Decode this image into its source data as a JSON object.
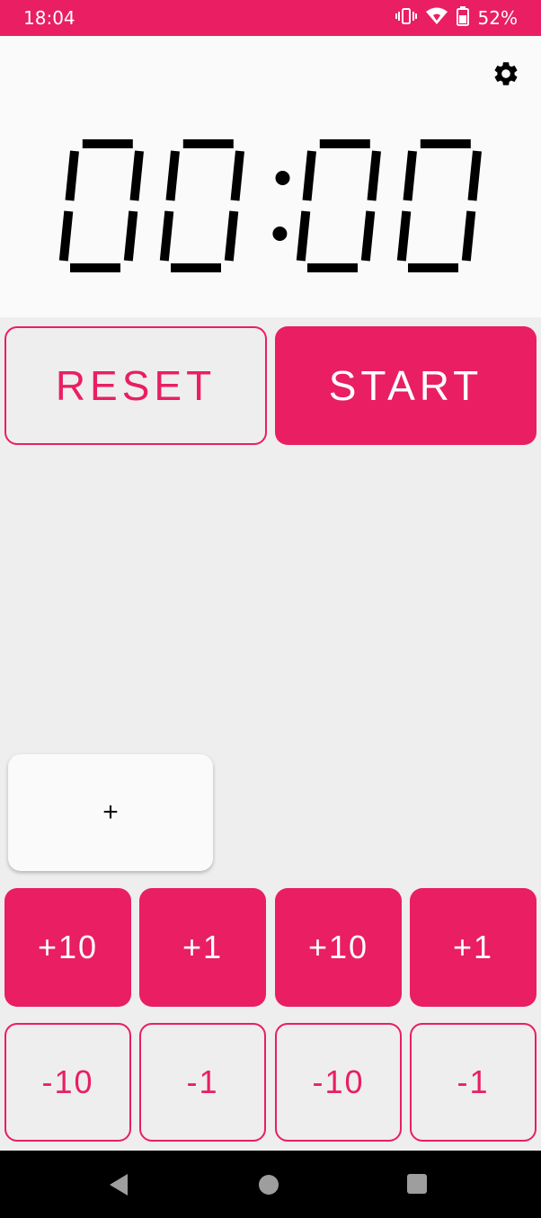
{
  "status_bar": {
    "time": "18:04",
    "battery_percent": "52%",
    "color": "#e91e63"
  },
  "timer": {
    "display": "00:00",
    "minutes": "00",
    "seconds": "00"
  },
  "icons": {
    "settings": "gear-icon",
    "vibrate": "vibrate-icon",
    "wifi": "wifi-icon",
    "battery": "battery-icon"
  },
  "controls": {
    "reset_label": "RESET",
    "start_label": "START"
  },
  "add_card": {
    "label": "+"
  },
  "increment_buttons": [
    "+10",
    "+1",
    "+10",
    "+1"
  ],
  "decrement_buttons": [
    "-10",
    "-1",
    "-10",
    "-1"
  ],
  "accent_color": "#e91e63"
}
